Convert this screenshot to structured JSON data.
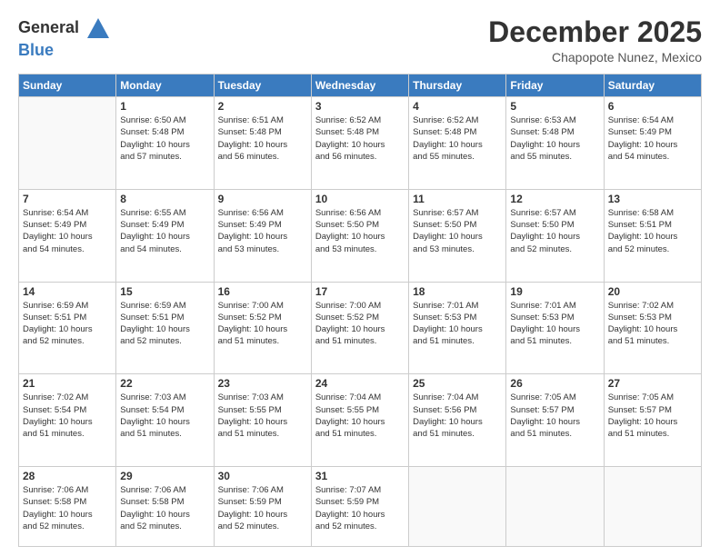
{
  "header": {
    "logo_general": "General",
    "logo_blue": "Blue",
    "month_year": "December 2025",
    "location": "Chapopote Nunez, Mexico"
  },
  "days_of_week": [
    "Sunday",
    "Monday",
    "Tuesday",
    "Wednesday",
    "Thursday",
    "Friday",
    "Saturday"
  ],
  "weeks": [
    [
      {
        "day": "",
        "info": ""
      },
      {
        "day": "1",
        "info": "Sunrise: 6:50 AM\nSunset: 5:48 PM\nDaylight: 10 hours\nand 57 minutes."
      },
      {
        "day": "2",
        "info": "Sunrise: 6:51 AM\nSunset: 5:48 PM\nDaylight: 10 hours\nand 56 minutes."
      },
      {
        "day": "3",
        "info": "Sunrise: 6:52 AM\nSunset: 5:48 PM\nDaylight: 10 hours\nand 56 minutes."
      },
      {
        "day": "4",
        "info": "Sunrise: 6:52 AM\nSunset: 5:48 PM\nDaylight: 10 hours\nand 55 minutes."
      },
      {
        "day": "5",
        "info": "Sunrise: 6:53 AM\nSunset: 5:48 PM\nDaylight: 10 hours\nand 55 minutes."
      },
      {
        "day": "6",
        "info": "Sunrise: 6:54 AM\nSunset: 5:49 PM\nDaylight: 10 hours\nand 54 minutes."
      }
    ],
    [
      {
        "day": "7",
        "info": "Sunrise: 6:54 AM\nSunset: 5:49 PM\nDaylight: 10 hours\nand 54 minutes."
      },
      {
        "day": "8",
        "info": "Sunrise: 6:55 AM\nSunset: 5:49 PM\nDaylight: 10 hours\nand 54 minutes."
      },
      {
        "day": "9",
        "info": "Sunrise: 6:56 AM\nSunset: 5:49 PM\nDaylight: 10 hours\nand 53 minutes."
      },
      {
        "day": "10",
        "info": "Sunrise: 6:56 AM\nSunset: 5:50 PM\nDaylight: 10 hours\nand 53 minutes."
      },
      {
        "day": "11",
        "info": "Sunrise: 6:57 AM\nSunset: 5:50 PM\nDaylight: 10 hours\nand 53 minutes."
      },
      {
        "day": "12",
        "info": "Sunrise: 6:57 AM\nSunset: 5:50 PM\nDaylight: 10 hours\nand 52 minutes."
      },
      {
        "day": "13",
        "info": "Sunrise: 6:58 AM\nSunset: 5:51 PM\nDaylight: 10 hours\nand 52 minutes."
      }
    ],
    [
      {
        "day": "14",
        "info": "Sunrise: 6:59 AM\nSunset: 5:51 PM\nDaylight: 10 hours\nand 52 minutes."
      },
      {
        "day": "15",
        "info": "Sunrise: 6:59 AM\nSunset: 5:51 PM\nDaylight: 10 hours\nand 52 minutes."
      },
      {
        "day": "16",
        "info": "Sunrise: 7:00 AM\nSunset: 5:52 PM\nDaylight: 10 hours\nand 51 minutes."
      },
      {
        "day": "17",
        "info": "Sunrise: 7:00 AM\nSunset: 5:52 PM\nDaylight: 10 hours\nand 51 minutes."
      },
      {
        "day": "18",
        "info": "Sunrise: 7:01 AM\nSunset: 5:53 PM\nDaylight: 10 hours\nand 51 minutes."
      },
      {
        "day": "19",
        "info": "Sunrise: 7:01 AM\nSunset: 5:53 PM\nDaylight: 10 hours\nand 51 minutes."
      },
      {
        "day": "20",
        "info": "Sunrise: 7:02 AM\nSunset: 5:53 PM\nDaylight: 10 hours\nand 51 minutes."
      }
    ],
    [
      {
        "day": "21",
        "info": "Sunrise: 7:02 AM\nSunset: 5:54 PM\nDaylight: 10 hours\nand 51 minutes."
      },
      {
        "day": "22",
        "info": "Sunrise: 7:03 AM\nSunset: 5:54 PM\nDaylight: 10 hours\nand 51 minutes."
      },
      {
        "day": "23",
        "info": "Sunrise: 7:03 AM\nSunset: 5:55 PM\nDaylight: 10 hours\nand 51 minutes."
      },
      {
        "day": "24",
        "info": "Sunrise: 7:04 AM\nSunset: 5:55 PM\nDaylight: 10 hours\nand 51 minutes."
      },
      {
        "day": "25",
        "info": "Sunrise: 7:04 AM\nSunset: 5:56 PM\nDaylight: 10 hours\nand 51 minutes."
      },
      {
        "day": "26",
        "info": "Sunrise: 7:05 AM\nSunset: 5:57 PM\nDaylight: 10 hours\nand 51 minutes."
      },
      {
        "day": "27",
        "info": "Sunrise: 7:05 AM\nSunset: 5:57 PM\nDaylight: 10 hours\nand 51 minutes."
      }
    ],
    [
      {
        "day": "28",
        "info": "Sunrise: 7:06 AM\nSunset: 5:58 PM\nDaylight: 10 hours\nand 52 minutes."
      },
      {
        "day": "29",
        "info": "Sunrise: 7:06 AM\nSunset: 5:58 PM\nDaylight: 10 hours\nand 52 minutes."
      },
      {
        "day": "30",
        "info": "Sunrise: 7:06 AM\nSunset: 5:59 PM\nDaylight: 10 hours\nand 52 minutes."
      },
      {
        "day": "31",
        "info": "Sunrise: 7:07 AM\nSunset: 5:59 PM\nDaylight: 10 hours\nand 52 minutes."
      },
      {
        "day": "",
        "info": ""
      },
      {
        "day": "",
        "info": ""
      },
      {
        "day": "",
        "info": ""
      }
    ]
  ]
}
